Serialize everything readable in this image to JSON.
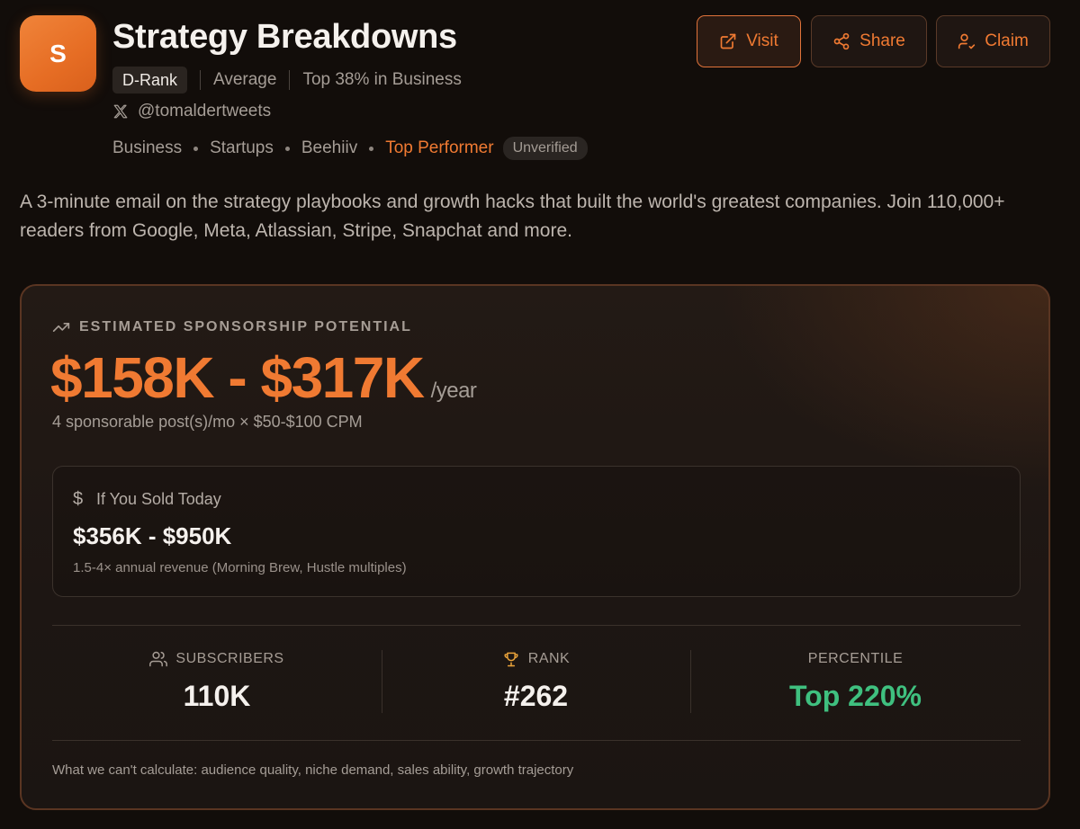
{
  "header": {
    "logo_letter": "S",
    "title": "Strategy Breakdowns",
    "rank_badge": "D-Rank",
    "rating": "Average",
    "top_percent": "Top 38% in Business",
    "handle": "@tomaldertweets",
    "tags": [
      "Business",
      "Startups",
      "Beehiiv"
    ],
    "highlight_tag": "Top Performer",
    "verification": "Unverified"
  },
  "actions": {
    "visit_label": "Visit",
    "share_label": "Share",
    "claim_label": "Claim"
  },
  "description": "A 3-minute email on the strategy playbooks and growth hacks that built the world's greatest companies. Join 110,000+ readers from Google, Meta, Atlassian, Stripe, Snapchat and more.",
  "sponsorship": {
    "label": "ESTIMATED SPONSORSHIP POTENTIAL",
    "range": "$158K - $317K",
    "period": "/year",
    "calc_note": "4 sponsorable post(s)/mo × $50-$100 CPM"
  },
  "sold_today": {
    "heading": "If You Sold Today",
    "range": "$356K - $950K",
    "note": "1.5-4× annual revenue (Morning Brew, Hustle multiples)"
  },
  "stats": {
    "subscribers_label": "SUBSCRIBERS",
    "subscribers_value": "110K",
    "rank_label": "RANK",
    "rank_value": "#262",
    "percentile_label": "PERCENTILE",
    "percentile_value": "Top 220%"
  },
  "footnote": "What we can't calculate: audience quality, niche demand, sales ability, growth trajectory",
  "colors": {
    "accent": "#f07a32",
    "positive": "#3fc07f",
    "background": "#120d0a"
  }
}
